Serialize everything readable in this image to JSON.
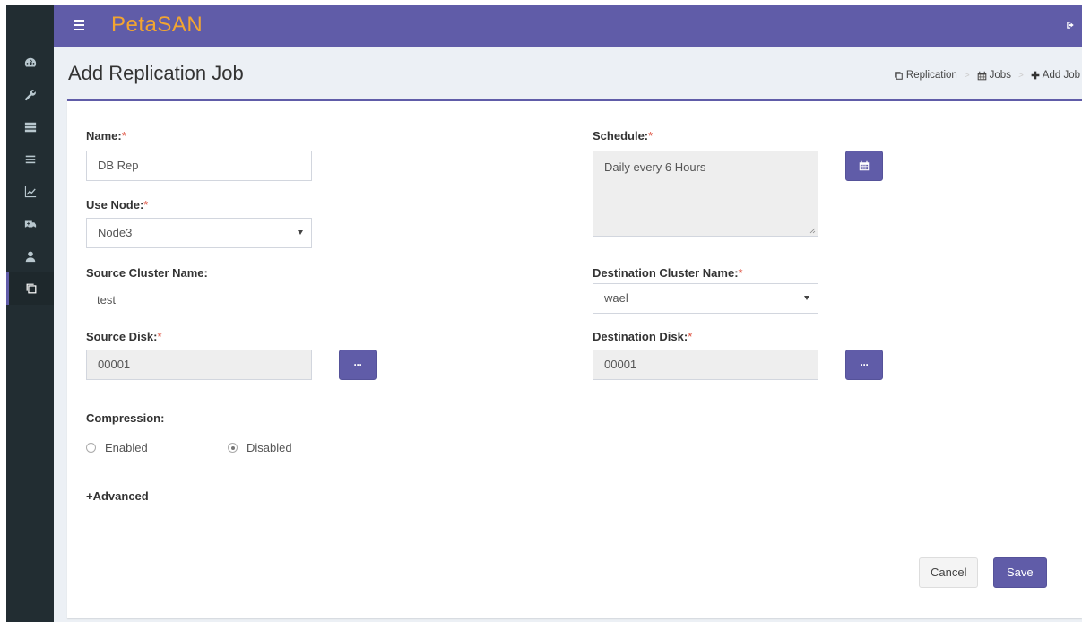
{
  "app": {
    "logo": "PetaSAN"
  },
  "sidebar": {
    "items": [
      {
        "icon": "dashboard-icon"
      },
      {
        "icon": "wrench-icon"
      },
      {
        "icon": "server-icon"
      },
      {
        "icon": "list-icon"
      },
      {
        "icon": "line-chart-icon"
      },
      {
        "icon": "ambulance-icon"
      },
      {
        "icon": "user-icon"
      },
      {
        "icon": "copy-icon"
      }
    ]
  },
  "page": {
    "title": "Add Replication Job",
    "breadcrumb": {
      "replication": "Replication",
      "jobs": "Jobs",
      "add_job": "Add Job"
    }
  },
  "form": {
    "name_label": "Name:",
    "name_value": "DB Rep",
    "node_label": "Use Node:",
    "node_value": "Node3",
    "source_cluster_label": "Source Cluster Name:",
    "source_cluster_value": "test",
    "source_disk_label": "Source Disk:",
    "source_disk_value": "00001",
    "schedule_label": "Schedule:",
    "schedule_value": "Daily every 6 Hours",
    "dest_cluster_label": "Destination Cluster Name:",
    "dest_cluster_value": "wael",
    "dest_disk_label": "Destination Disk:",
    "dest_disk_value": "00001",
    "compression_label": "Compression:",
    "compression_enabled": "Enabled",
    "compression_disabled": "Disabled",
    "compression_selected": "Disabled",
    "advanced_label": "+Advanced",
    "required_mark": "*",
    "ellipsis": "···"
  },
  "actions": {
    "cancel": "Cancel",
    "save": "Save"
  },
  "colors": {
    "accent": "#605ca8",
    "sidebar": "#222d32",
    "required": "#dd4b39"
  }
}
